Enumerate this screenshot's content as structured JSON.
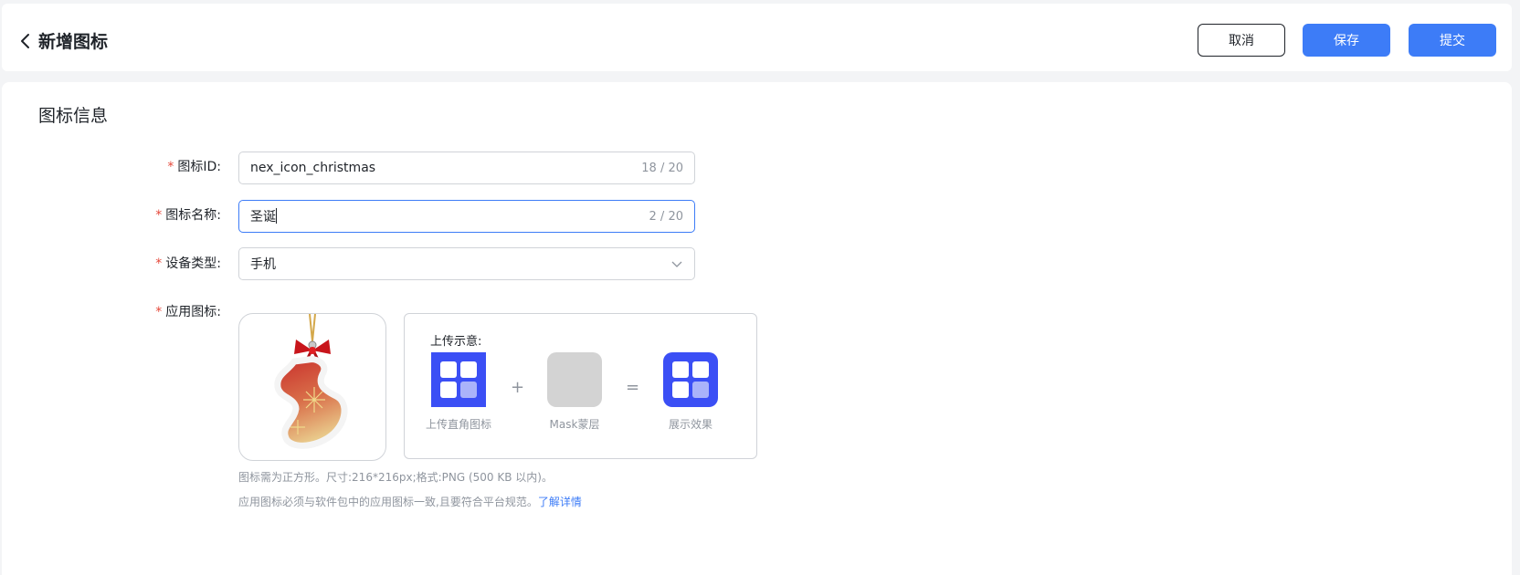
{
  "header": {
    "title": "新增图标",
    "cancel_label": "取消",
    "save_label": "保存",
    "submit_label": "提交"
  },
  "section": {
    "title": "图标信息"
  },
  "form": {
    "icon_id": {
      "label": "图标ID:",
      "value": "nex_icon_christmas",
      "count": "18 / 20"
    },
    "icon_name": {
      "label": "图标名称:",
      "value": "圣诞",
      "count": "2 / 20"
    },
    "device_type": {
      "label": "设备类型:",
      "value": "手机"
    },
    "app_icon": {
      "label": "应用图标:"
    }
  },
  "demo": {
    "title": "上传示意:",
    "item1": "上传直角图标",
    "plus": "+",
    "item2": "Mask蒙层",
    "equals": "=",
    "item3": "展示效果"
  },
  "hints": {
    "line1": "图标需为正方形。尺寸:216*216px;格式:PNG (500 KB 以内)。",
    "line2": "应用图标必须与软件包中的应用图标一致,且要符合平台规范。",
    "link": "了解详情"
  },
  "colors": {
    "primary": "#3d7cf7",
    "required": "#e5483a",
    "demo_blue": "#3b4ff5"
  }
}
